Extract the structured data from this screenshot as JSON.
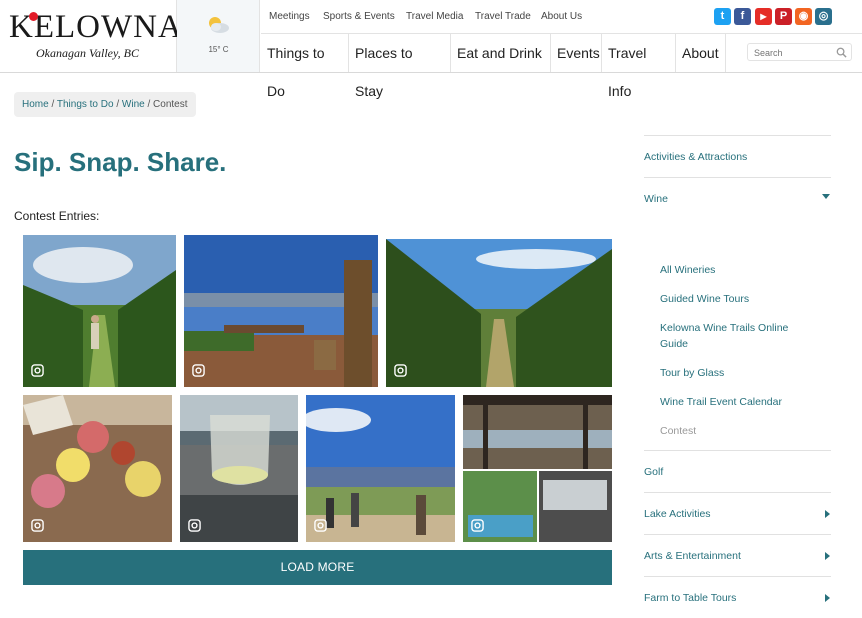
{
  "logo": {
    "name": "KELOWNA",
    "tagline": "Okanagan Valley, BC"
  },
  "weather": {
    "temp": "15° C",
    "icon": "partly-cloudy-icon"
  },
  "top_links": [
    "Meetings",
    "Sports & Events",
    "Travel Media",
    "Travel Trade",
    "About Us"
  ],
  "social": [
    {
      "name": "twitter-icon",
      "glyph": "t",
      "color": "#1da1f2"
    },
    {
      "name": "facebook-icon",
      "glyph": "f",
      "color": "#3b5998"
    },
    {
      "name": "youtube-icon",
      "glyph": "▶",
      "color": "#e52d27"
    },
    {
      "name": "pinterest-icon",
      "glyph": "P",
      "color": "#cb2027"
    },
    {
      "name": "rss-icon",
      "glyph": "◉",
      "color": "#f26522"
    },
    {
      "name": "instagram-icon",
      "glyph": "◎",
      "color": "#2a6f8d"
    }
  ],
  "main_nav": [
    "Things to Do",
    "Places to Stay",
    "Eat and Drink",
    "Events",
    "Travel Info",
    "About"
  ],
  "search": {
    "placeholder": "Search"
  },
  "breadcrumb": {
    "home": "Home",
    "things": "Things to Do",
    "wine": "Wine",
    "current": "Contest",
    "sep": "/"
  },
  "page_title": "Sip. Snap. Share.",
  "entries_label": "Contest Entries:",
  "load_more": "LOAD MORE",
  "sidebar": {
    "items": [
      {
        "label": "Activities & Attractions",
        "arrow": "none"
      },
      {
        "label": "Wine",
        "arrow": "down"
      },
      {
        "label": "Golf",
        "arrow": "none"
      },
      {
        "label": "Lake Activities",
        "arrow": "right"
      },
      {
        "label": "Arts & Entertainment",
        "arrow": "right"
      },
      {
        "label": "Farm to Table Tours",
        "arrow": "right"
      }
    ],
    "wine_sub": [
      "All Wineries",
      "Guided Wine Tours",
      "Kelowna Wine Trails Online Guide",
      "Tour by Glass",
      "Wine Trail Event Calendar",
      "Contest"
    ]
  },
  "colors": {
    "accent": "#27707c",
    "brand_red": "#e21b28"
  }
}
